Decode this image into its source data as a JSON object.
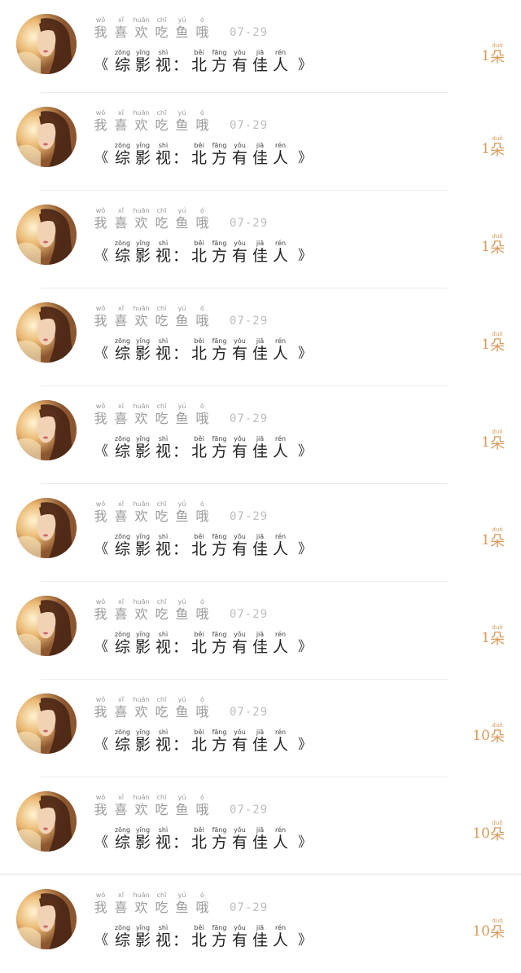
{
  "username": {
    "chars": [
      {
        "hz": "我",
        "py": "wǒ"
      },
      {
        "hz": "喜",
        "py": "xǐ"
      },
      {
        "hz": "欢",
        "py": "huān"
      },
      {
        "hz": "吃",
        "py": "chī"
      },
      {
        "hz": "鱼",
        "py": "yú"
      },
      {
        "hz": "哦",
        "py": "ó"
      }
    ]
  },
  "title": {
    "open_bracket": "《",
    "close_bracket": "》",
    "colon": "：",
    "prefix": [
      {
        "hz": "综",
        "py": "zōng"
      },
      {
        "hz": "影",
        "py": "yǐng"
      },
      {
        "hz": "视",
        "py": "shì"
      }
    ],
    "main": [
      {
        "hz": "北",
        "py": "běi"
      },
      {
        "hz": "方",
        "py": "fāng"
      },
      {
        "hz": "有",
        "py": "yǒu"
      },
      {
        "hz": "佳",
        "py": "jiā"
      },
      {
        "hz": "人",
        "py": "rén"
      }
    ]
  },
  "unit": {
    "hz": "朵",
    "py": "duǒ"
  },
  "entries": [
    {
      "date": "07-29",
      "count": "1"
    },
    {
      "date": "07-29",
      "count": "1"
    },
    {
      "date": "07-29",
      "count": "1"
    },
    {
      "date": "07-29",
      "count": "1"
    },
    {
      "date": "07-29",
      "count": "1"
    },
    {
      "date": "07-29",
      "count": "1"
    },
    {
      "date": "07-29",
      "count": "1"
    },
    {
      "date": "07-29",
      "count": "10"
    },
    {
      "date": "07-29",
      "count": "10"
    },
    {
      "date": "07-29",
      "count": "10"
    }
  ],
  "colors": {
    "count_accent": "#d99a5a",
    "username_gray": "#9a9a9a",
    "date_gray": "#bdbdbd",
    "title_dark": "#222222"
  }
}
